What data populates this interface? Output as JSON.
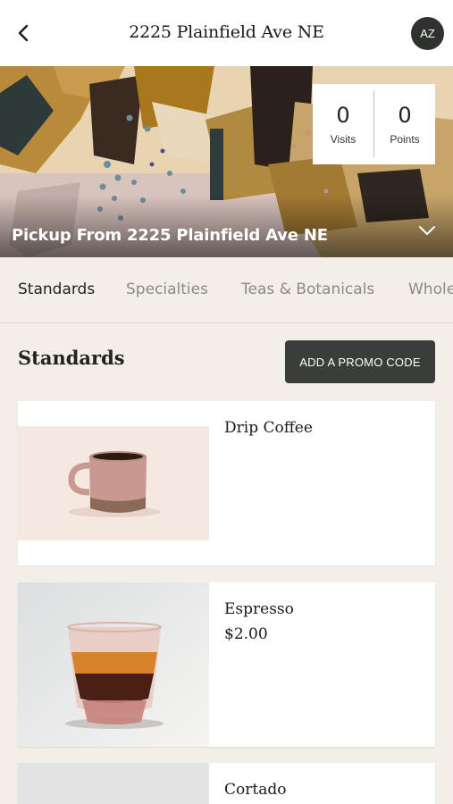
{
  "header": {
    "title": "2225 Plainfield Ave NE",
    "avatar_initials": "AZ",
    "back_icon": "chevron-left-icon"
  },
  "hero": {
    "pickup_label": "Pickup From 2225 Plainfield Ave NE",
    "expand_icon": "chevron-down-icon",
    "stats": {
      "visits_value": "0",
      "visits_label": "Visits",
      "points_value": "0",
      "points_label": "Points"
    }
  },
  "tabs": [
    "Standards",
    "Specialties",
    "Teas & Botanicals",
    "Whole"
  ],
  "section": {
    "title": "Standards",
    "promo_button": "ADD A PROMO CODE"
  },
  "items": [
    {
      "name": "Drip Coffee",
      "price": ""
    },
    {
      "name": "Espresso",
      "price": "$2.00"
    },
    {
      "name": "Cortado",
      "price": ""
    }
  ],
  "colors": {
    "background": "#f3efe8",
    "dark_button": "#3a3d39",
    "avatar_bg": "#2f322f"
  }
}
